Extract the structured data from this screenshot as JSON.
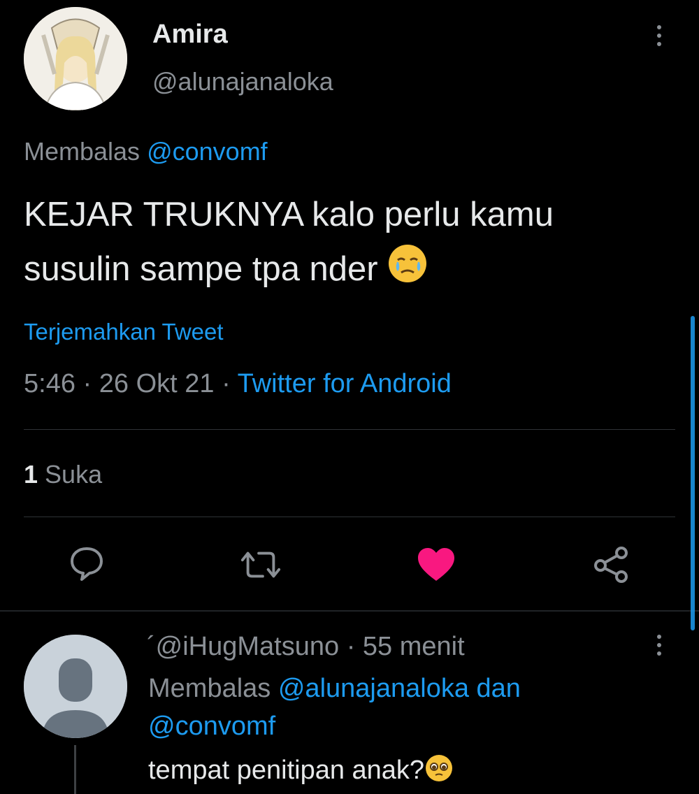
{
  "tweet": {
    "author_name": "Amira",
    "author_handle": "@alunajanaloka",
    "reply_prefix": "Membalas",
    "reply_to": "@convomf",
    "text_line1": "KEJAR TRUKNYA kalo perlu kamu",
    "text_line2": "susulin sampe tpa nder",
    "text_emoji": "crying-face-emoji",
    "translate_label": "Terjemahkan Tweet",
    "time": "5:46",
    "date": "26 Okt 21",
    "separator": "·",
    "source": "Twitter for Android",
    "like_count": "1",
    "like_label": "Suka"
  },
  "actions": {
    "reply_icon": "reply-icon",
    "retweet_icon": "retweet-icon",
    "like_icon": "heart-icon",
    "share_icon": "share-icon",
    "like_color": "#f91880"
  },
  "reply": {
    "handle_prefix": "´",
    "handle": "@iHugMatsuno",
    "separator": "·",
    "time": "55 menit",
    "reply_prefix": "Membalas",
    "reply_to_1": "@alunajanaloka",
    "reply_joiner": "dan",
    "reply_to_2": "@convomf",
    "text": "tempat penitipan anak?",
    "text_emoji": "pleading-face-emoji"
  },
  "colors": {
    "background": "#000000",
    "link": "#1d9bf0",
    "muted": "#8b9096",
    "text": "#e7e9ea"
  }
}
